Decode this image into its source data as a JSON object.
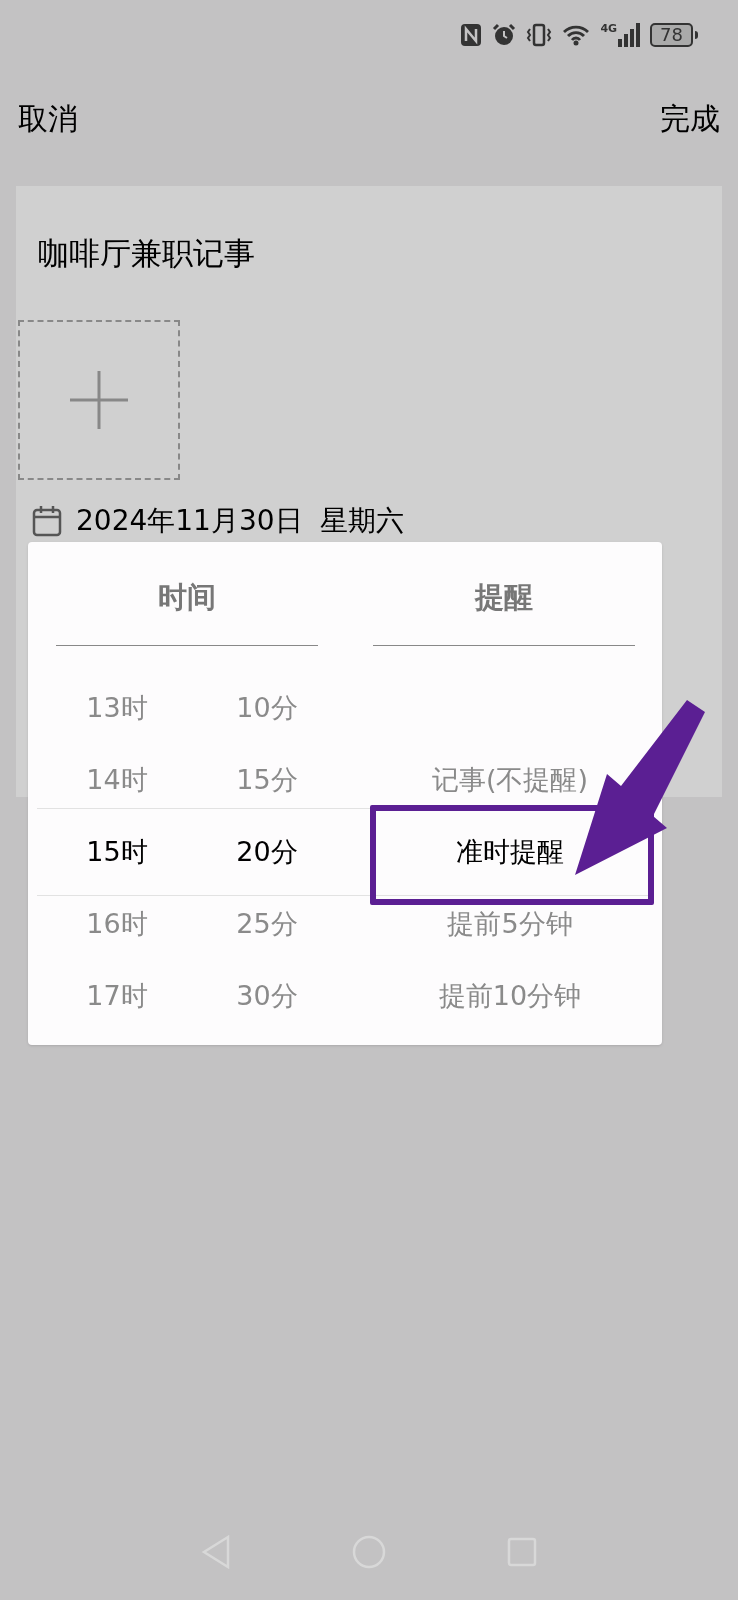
{
  "status_bar": {
    "network": "4G",
    "battery": "78"
  },
  "top_bar": {
    "cancel": "取消",
    "done": "完成"
  },
  "note": {
    "title": "咖啡厅兼职记事",
    "date": "2024年11月30日  星期六"
  },
  "picker": {
    "tabs": [
      {
        "label": "时间"
      },
      {
        "label": "提醒"
      }
    ],
    "hours": [
      {
        "label": "13时",
        "selected": false
      },
      {
        "label": "14时",
        "selected": false
      },
      {
        "label": "15时",
        "selected": true
      },
      {
        "label": "16时",
        "selected": false
      },
      {
        "label": "17时",
        "selected": false
      }
    ],
    "minutes": [
      {
        "label": "10分",
        "selected": false
      },
      {
        "label": "15分",
        "selected": false
      },
      {
        "label": "20分",
        "selected": true
      },
      {
        "label": "25分",
        "selected": false
      },
      {
        "label": "30分",
        "selected": false
      }
    ],
    "reminders": [
      {
        "label": "记事(不提醒)",
        "selected": false
      },
      {
        "label": "准时提醒",
        "selected": true
      },
      {
        "label": "提前5分钟",
        "selected": false
      },
      {
        "label": "提前10分钟",
        "selected": false
      }
    ]
  }
}
